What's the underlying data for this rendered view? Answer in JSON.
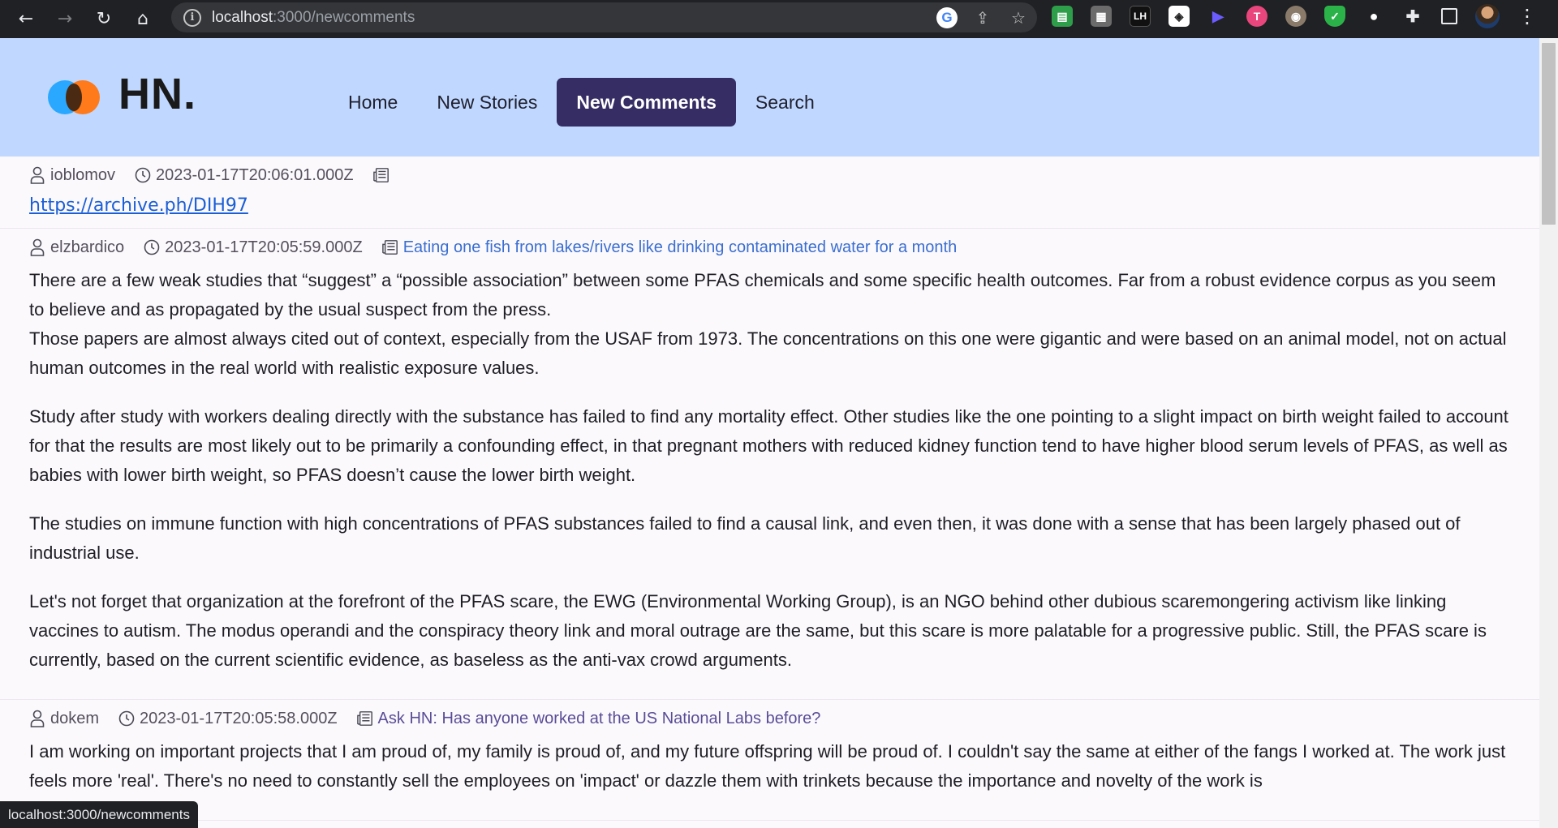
{
  "browser": {
    "url_host": "localhost",
    "url_path": ":3000/newcomments",
    "status_text": "localhost:3000/newcomments"
  },
  "site": {
    "logo_text": "HN.",
    "nav": [
      {
        "label": "Home",
        "active": false
      },
      {
        "label": "New Stories",
        "active": false
      },
      {
        "label": "New Comments",
        "active": true
      },
      {
        "label": "Search",
        "active": false
      }
    ]
  },
  "comments": [
    {
      "author": "ioblomov",
      "time": "2023-01-17T20:06:01.000Z",
      "story": "",
      "link": "https://archive.ph/DIH97",
      "paragraphs": []
    },
    {
      "author": "elzbardico",
      "time": "2023-01-17T20:05:59.000Z",
      "story": "Eating one fish from lakes/rivers like drinking contaminated water for a month",
      "link": "",
      "paragraphs": [
        "There are a few weak studies that “suggest” a “possible association” between some PFAS chemicals and some specific health outcomes. Far from a robust evidence corpus as you seem to believe and as propagated by the usual suspect from the press.",
        "Those papers are almost always cited out of context, especially from the USAF from 1973. The concentrations on this one were gigantic and were based on an animal model, not on actual human outcomes in the real world with realistic exposure values.",
        "Study after study with workers dealing directly with the substance has failed to find any mortality effect. Other studies like the one pointing to a slight impact on birth weight failed to account for that the results are most likely out to be primarily a confounding effect, in that pregnant mothers with reduced kidney function tend to have higher blood serum levels of PFAS, as well as babies with lower birth weight, so PFAS doesn’t cause the lower birth weight.",
        "The studies on immune function with high concentrations of PFAS substances failed to find a causal link, and even then, it was done with a sense that has been largely phased out of industrial use.",
        "Let's not forget that organization at the forefront of the PFAS scare, the EWG (Environmental Working Group), is an NGO behind other dubious scaremongering activism like linking vaccines to autism. The modus operandi and the conspiracy theory link and moral outrage are the same, but this scare is more palatable for a progressive public. Still, the PFAS scare is currently, based on the current scientific evidence, as baseless as the anti-vax crowd arguments."
      ]
    },
    {
      "author": "dokem",
      "time": "2023-01-17T20:05:58.000Z",
      "story": "Ask HN: Has anyone worked at the US National Labs before?",
      "link": "",
      "paragraphs": [
        "I am working on important projects that I am proud of, my family is proud of, and my future offspring will be proud of. I couldn't say the same at either of the fangs I worked at. The work just feels more 'real'. There's no need to constantly sell the employees on 'impact' or dazzle them with trinkets because the importance and novelty of the work is"
      ]
    }
  ]
}
